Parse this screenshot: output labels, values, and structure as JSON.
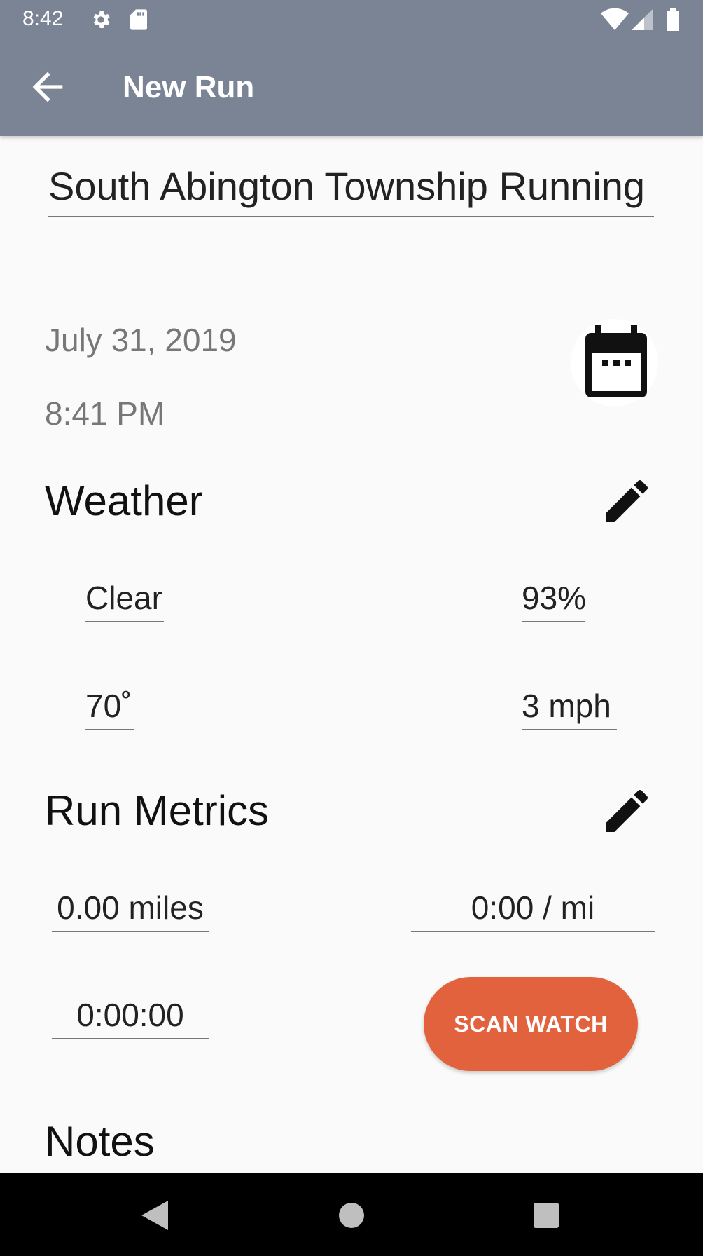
{
  "status_bar": {
    "time": "8:42",
    "icons": [
      "settings-icon",
      "sd-card-icon",
      "wifi-icon",
      "signal-icon",
      "battery-icon"
    ]
  },
  "app_bar": {
    "title": "New Run",
    "back_icon": "arrow-back-icon",
    "color": "#7b8495"
  },
  "run": {
    "name": "South Abington Township Running",
    "date": "July 31, 2019",
    "time": "8:41 PM",
    "calendar_icon": "calendar-icon"
  },
  "weather": {
    "title": "Weather",
    "edit_icon": "pencil-icon",
    "condition": "Clear",
    "humidity": "93%",
    "temperature": "70˚",
    "wind": "3 mph"
  },
  "metrics": {
    "title": "Run Metrics",
    "edit_icon": "pencil-icon",
    "distance": "0.00 miles",
    "pace": "0:00 / mi",
    "duration": "0:00:00",
    "scan_label": "SCAN WATCH",
    "accent": "#e2623e"
  },
  "notes": {
    "title": "Notes"
  },
  "nav_bar": {
    "icons": [
      "back-triangle-icon",
      "home-circle-icon",
      "recents-square-icon"
    ]
  }
}
